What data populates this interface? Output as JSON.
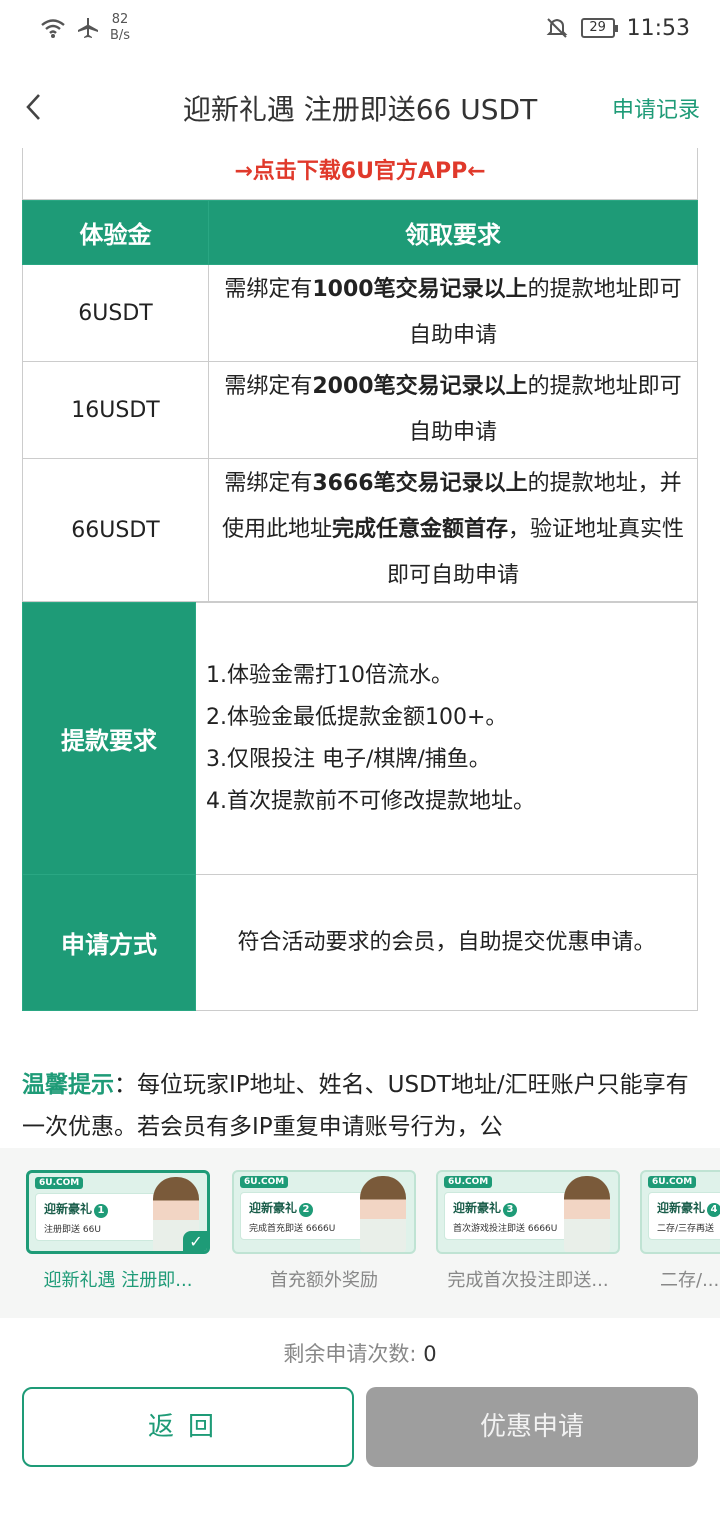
{
  "status_bar": {
    "speed_value": "82",
    "speed_unit": "B/s",
    "battery": "29",
    "time": "11:53",
    "icons": [
      "wifi-icon",
      "airplane-icon",
      "mute-icon",
      "battery-icon"
    ]
  },
  "navbar": {
    "title": "迎新礼遇 注册即送66 USDT",
    "record": "申请记录"
  },
  "download_link": "→点击下载6U官方APP←",
  "table": {
    "header_amount": "体验金",
    "header_requirement": "领取要求",
    "rows": [
      {
        "amount": "6USDT",
        "pre": "需绑定有",
        "bold": "1000笔交易记录以上",
        "post": "的提款地址即可自助申请"
      },
      {
        "amount": "16USDT",
        "pre": "需绑定有",
        "bold": "2000笔交易记录以上",
        "post": "的提款地址即可自助申请"
      },
      {
        "amount": "66USDT",
        "pre": "需绑定有",
        "bold": "3666笔交易记录以上",
        "mid": "的提款地址，并使用此地址",
        "bold2": "完成任意金额首存",
        "post": "，验证地址真实性即可自助申请"
      }
    ],
    "withdraw_label": "提款要求",
    "withdraw_items": [
      "1.体验金需打10倍流水。",
      "2.体验金最低提款金额100+。",
      "3.仅限投注 电子/棋牌/捕鱼。",
      "4.首次提款前不可修改提款地址。"
    ],
    "apply_label": "申请方式",
    "apply_text": "符合活动要求的会员，自助提交优惠申请。"
  },
  "tips": {
    "label": "温馨提示",
    "text": "：每位玩家IP地址、姓名、USDT地址/汇旺账户只能享有一次优惠。若会员有多IP重复申请账号行为，公"
  },
  "promos": [
    {
      "brand": "6U.COM",
      "title": "迎新豪礼",
      "num": "1",
      "sub": "注册即送 66U",
      "caption": "迎新礼遇 注册即..."
    },
    {
      "brand": "6U.COM",
      "title": "迎新豪礼",
      "num": "2",
      "sub": "完成首充即送 6666U",
      "caption": "首充额外奖励"
    },
    {
      "brand": "6U.COM",
      "title": "迎新豪礼",
      "num": "3",
      "sub": "首次游戏投注即送 6666U",
      "caption": "完成首次投注即送..."
    },
    {
      "brand": "6U.COM",
      "title": "迎新豪礼",
      "num": "4",
      "sub": "二存/三存再送",
      "caption": "二存/..."
    }
  ],
  "remaining": {
    "label": "剩余申请次数:",
    "value": "0"
  },
  "buttons": {
    "back": "返回",
    "apply": "优惠申请"
  }
}
